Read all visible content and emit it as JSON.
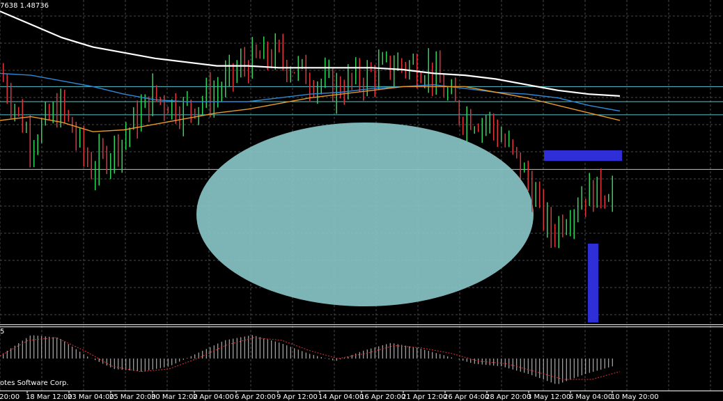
{
  "header": {
    "quote": "7638 1.48736"
  },
  "indicator": {
    "label": "5"
  },
  "copyright": "otes Software Corp.",
  "colors": {
    "background": "#000000",
    "grid": "#4a4a4a",
    "up_candle": "#2fd35a",
    "down_candle": "#e0333a",
    "ma_white": "#ffffff",
    "ma_blue": "#2e8ad8",
    "ma_orange": "#e89a2a",
    "level_line": "#56c6cf",
    "ellipse_fill": "#87c3c4",
    "marker": "#2f2fd8",
    "histogram": "#cfcfcf",
    "signal": "#e0333a",
    "axis_text": "#ffffff"
  },
  "chart_data": {
    "type": "line",
    "title": "",
    "x_ticks": [
      "r 20:00",
      "18 Mar 12:00",
      "23 Mar 04:00",
      "25 Mar 20:00",
      "30 Mar 12:00",
      "2 Apr 04:00",
      "6 Apr 20:00",
      "9 Apr 12:00",
      "14 Apr 04:00",
      "16 Apr 20:00",
      "21 Apr 12:00",
      "26 Apr 04:00",
      "28 Apr 20:00",
      "3 May 12:00",
      "6 May 04:00",
      "10 May 20:00"
    ],
    "x_index": [
      0,
      0.05,
      0.1,
      0.15,
      0.2,
      0.25,
      0.3,
      0.35,
      0.4,
      0.45,
      0.5,
      0.55,
      0.6,
      0.65,
      0.7,
      0.75,
      0.8,
      0.85,
      0.9,
      0.95,
      1.0
    ],
    "price_path": [
      1.4874,
      1.4838,
      1.4855,
      1.4822,
      1.4838,
      1.4861,
      1.4854,
      1.4862,
      1.4878,
      1.4883,
      1.4872,
      1.4865,
      1.4872,
      1.4878,
      1.4876,
      1.4852,
      1.4847,
      1.4824,
      1.4788,
      1.4808,
      1.4812
    ],
    "series": [
      {
        "values": [
          1.4906,
          1.4899,
          1.4892,
          1.4887,
          1.4884,
          1.4881,
          1.4879,
          1.4877,
          1.4877,
          1.4876,
          1.4876,
          1.4876,
          1.4876,
          1.4875,
          1.4873,
          1.4872,
          1.487,
          1.4867,
          1.4864,
          1.4862,
          1.4861
        ]
      },
      {
        "values": [
          1.4873,
          1.4872,
          1.4869,
          1.4866,
          1.4862,
          1.4859,
          1.4858,
          1.4858,
          1.4858,
          1.486,
          1.4862,
          1.4863,
          1.4865,
          1.4866,
          1.4867,
          1.4865,
          1.4863,
          1.4862,
          1.486,
          1.4856,
          1.4853
        ]
      },
      {
        "values": [
          1.4848,
          1.485,
          1.4847,
          1.4842,
          1.4843,
          1.4846,
          1.4849,
          1.4852,
          1.4854,
          1.4857,
          1.486,
          1.4862,
          1.4864,
          1.4866,
          1.4866,
          1.4866,
          1.4863,
          1.486,
          1.4856,
          1.4852,
          1.4848
        ]
      }
    ],
    "horizontal_levels": [
      1.4866,
      1.4858,
      1.4851,
      1.4822
    ],
    "ylim": [
      1.474,
      1.4912
    ],
    "oscillator": {
      "histogram": [
        0.2,
        0.9,
        0.8,
        0.1,
        -0.4,
        -0.5,
        -0.3,
        0.2,
        0.7,
        0.9,
        0.6,
        0.2,
        -0.1,
        0.3,
        0.6,
        0.4,
        0.1,
        -0.2,
        -0.3,
        -0.6,
        -1.0,
        -0.6,
        -0.3
      ],
      "signal": [
        0.1,
        0.7,
        0.8,
        0.3,
        -0.3,
        -0.5,
        -0.4,
        0.0,
        0.5,
        0.8,
        0.7,
        0.3,
        0.0,
        0.2,
        0.5,
        0.4,
        0.2,
        -0.1,
        -0.2,
        -0.5,
        -0.8,
        -0.8,
        -0.5
      ],
      "ylim": [
        -1.2,
        1.2
      ]
    },
    "grid": true,
    "annotations": [
      {
        "type": "ellipse",
        "color": "#87c3c4"
      },
      {
        "type": "marker-bar-horizontal",
        "color": "#2f2fd8"
      },
      {
        "type": "marker-bar-vertical",
        "color": "#2f2fd8"
      }
    ]
  }
}
